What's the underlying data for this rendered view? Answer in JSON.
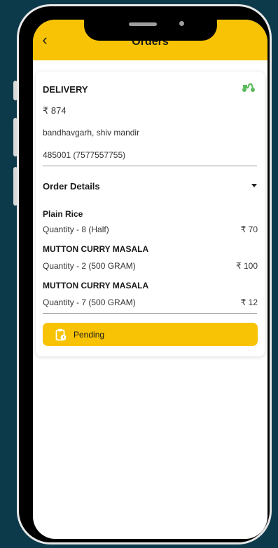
{
  "header": {
    "title": "Orders",
    "back_icon": "chevron-left-icon"
  },
  "order": {
    "type": "DELIVERY",
    "amount": "₹ 874",
    "address_line": "bandhavgarh, shiv mandir",
    "postal_phone": "485001 (7577557755)",
    "delivery_icon": "scooter-icon"
  },
  "details": {
    "heading": "Order Details",
    "items": [
      {
        "name": "Plain Rice",
        "quantity": "Quantity - 8 (Half)",
        "price": "₹ 70"
      },
      {
        "name": "MUTTON CURRY MASALA",
        "quantity": "Quantity - 2 (500 GRAM)",
        "price": "₹ 100"
      },
      {
        "name": "MUTTON CURRY MASALA",
        "quantity": "Quantity - 7 (500 GRAM)",
        "price": "₹ 12"
      }
    ]
  },
  "status": {
    "label": "Pending",
    "icon": "clipboard-clock-icon"
  },
  "colors": {
    "accent": "#f8c304",
    "background": "#0d3a4a",
    "delivery_icon": "#5cb85c"
  }
}
